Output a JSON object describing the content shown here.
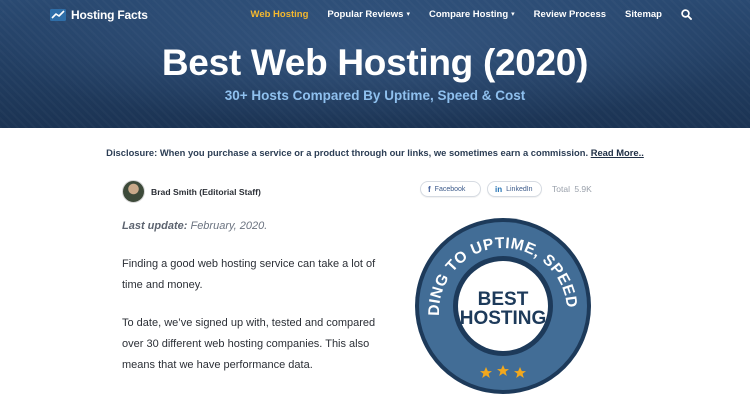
{
  "brand": {
    "name": "Hosting Facts"
  },
  "nav": {
    "items": [
      {
        "label": "Web Hosting"
      },
      {
        "label": "Popular Reviews"
      },
      {
        "label": "Compare Hosting"
      },
      {
        "label": "Review Process"
      },
      {
        "label": "Sitemap"
      }
    ],
    "search_icon": "search-icon"
  },
  "hero": {
    "title": "Best Web Hosting (2020)",
    "subtitle": "30+ Hosts Compared By Uptime, Speed & Cost"
  },
  "disclosure": {
    "text": "Disclosure: When you purchase a service or a product through our links, we sometimes earn a commission.",
    "link": "Read More.."
  },
  "author": {
    "name": "Brad Smith (Editorial Staff)"
  },
  "share": {
    "facebook": "Facebook",
    "linkedin": "LinkedIn",
    "total_label": "Total",
    "total_count": "5.9K"
  },
  "article": {
    "update_label": "Last update:",
    "update_date": "February, 2020.",
    "paragraphs": [
      "Finding a good web hosting service can take a lot of time and money.",
      "To date, we’ve signed up with, tested and compared over 30 different web hosting companies. This also means that we have performance data."
    ]
  },
  "badge": {
    "ring_text": "ACCORDING TO UPTIME, SPEED & COST",
    "line1": "BEST",
    "line2": "HOSTING",
    "stars": 3
  },
  "colors": {
    "hero_bg": "#1d3557",
    "nav_active": "#f5b82e",
    "subtitle": "#8fc0ee",
    "badge_ring": "#3e6a93",
    "badge_star": "#f2a81d"
  }
}
